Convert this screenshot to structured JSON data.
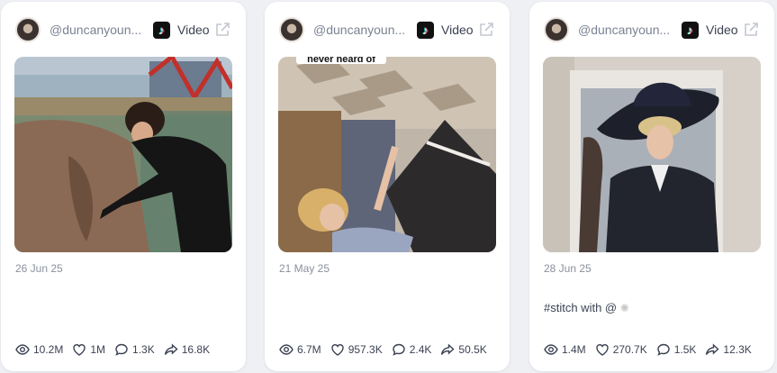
{
  "cards": [
    {
      "handle": "@duncanyoun...",
      "platform_icon": "tiktok-icon",
      "type_label": "Video",
      "date": "26 Jun 25",
      "caption": "",
      "stats": {
        "views": "10.2M",
        "likes": "1M",
        "comments": "1.3K",
        "shares": "16.8K"
      }
    },
    {
      "handle": "@duncanyoun...",
      "platform_icon": "tiktok-icon",
      "type_label": "Video",
      "date": "21 May 25",
      "caption": "",
      "thumbnail_overlay_text": "never heard of",
      "stats": {
        "views": "6.7M",
        "likes": "957.3K",
        "comments": "2.4K",
        "shares": "50.5K"
      }
    },
    {
      "handle": "@duncanyoun...",
      "platform_icon": "tiktok-icon",
      "type_label": "Video",
      "date": "28 Jun 25",
      "caption": "#stitch with @",
      "stats": {
        "views": "1.4M",
        "likes": "270.7K",
        "comments": "1.5K",
        "shares": "12.3K"
      }
    }
  ],
  "colors": {
    "card_bg": "#ffffff",
    "page_bg": "#eef0f4",
    "muted_text": "#8a909c",
    "icon_stroke": "#3b4252"
  }
}
